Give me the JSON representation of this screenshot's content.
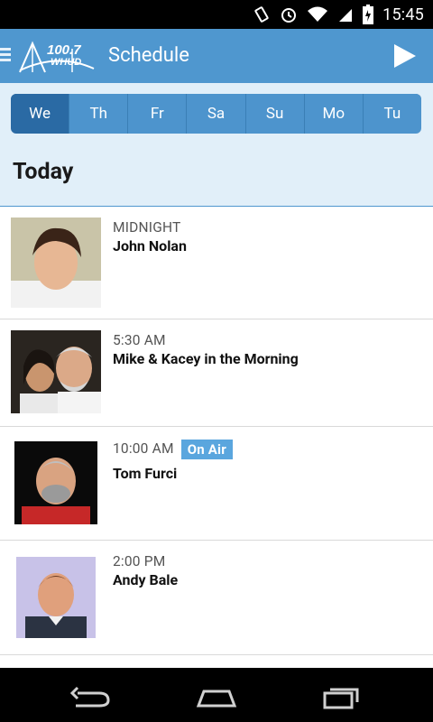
{
  "status": {
    "time": "15:45"
  },
  "app": {
    "title": "Schedule",
    "logo_text_top": "100.7",
    "logo_text_bottom": "WHUD"
  },
  "days": [
    "We",
    "Th",
    "Fr",
    "Sa",
    "Su",
    "Mo",
    "Tu"
  ],
  "section": {
    "title": "Today"
  },
  "shows": [
    {
      "time": "MIDNIGHT",
      "name": "John Nolan",
      "on_air": false
    },
    {
      "time": "5:30 AM",
      "name": "Mike & Kacey in the Morning",
      "on_air": false
    },
    {
      "time": "10:00 AM",
      "name": "Tom Furci",
      "on_air": true,
      "on_air_label": "On Air"
    },
    {
      "time": "2:00 PM",
      "name": "Andy Bale",
      "on_air": false
    }
  ],
  "colors": {
    "accent": "#4f97cf",
    "active_tab": "#2a6aa4",
    "sub_bg": "#e1eff9",
    "onair": "#5aa6de"
  },
  "icons": [
    "vibrate-icon",
    "alarm-icon",
    "wifi-icon",
    "signal-icon",
    "battery-icon",
    "menu-icon",
    "play-icon",
    "back-icon",
    "home-icon",
    "recents-icon"
  ]
}
